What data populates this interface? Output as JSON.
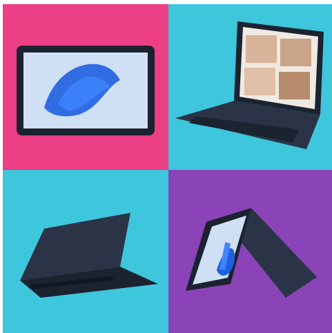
{
  "tiles": [
    {
      "subject": "tablet-landscape",
      "background": "#ec3f86"
    },
    {
      "subject": "laptop-video-call",
      "background": "#3ec6dc"
    },
    {
      "subject": "laptop-rear",
      "background": "#3ec6dc"
    },
    {
      "subject": "convertible-tent",
      "background": "#8a44b7"
    }
  ],
  "colors": {
    "device_body": "#2a3446",
    "device_dark": "#1b2230",
    "screen_blue": "#1f5fe0",
    "screen_bg": "#cfe0f4"
  }
}
